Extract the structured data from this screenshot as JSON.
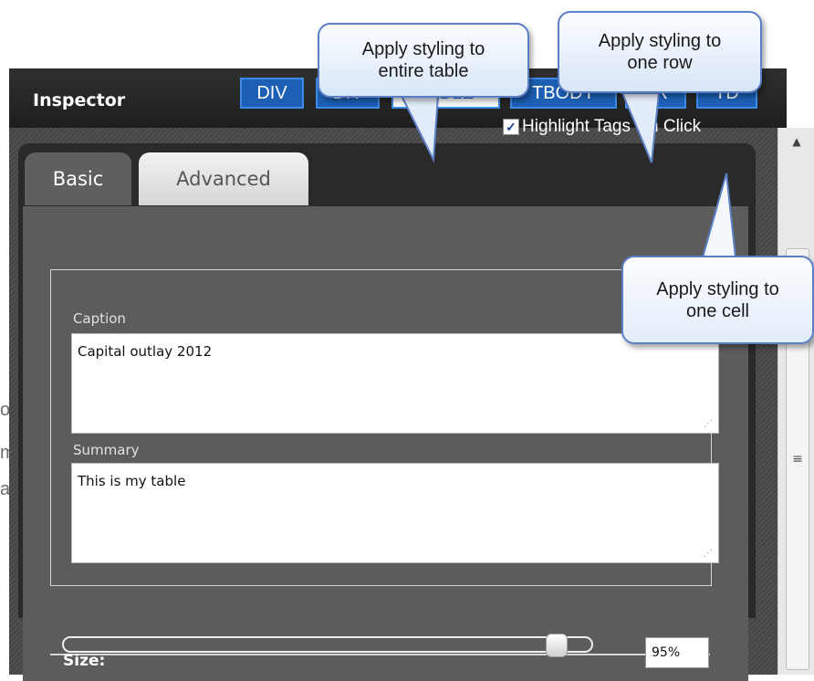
{
  "inspector": {
    "title": "Inspector",
    "tags": [
      "DIV",
      "DIV",
      "TABLE",
      "TBODY",
      "TR",
      "TD"
    ],
    "active_tag": "TABLE",
    "highlight_label": "Highlight Tags On Click",
    "highlight_checked": true
  },
  "tabs": {
    "basic": "Basic",
    "advanced": "Advanced",
    "active": "Basic"
  },
  "basic": {
    "caption_label": "Caption",
    "caption_value": "Capital outlay 2012",
    "summary_label": "Summary",
    "summary_value": "This is my table",
    "size_label": "Size:",
    "size_value": "95%",
    "size_fraction": 0.95
  },
  "callouts": {
    "table": "Apply styling to\nentire table",
    "row": "Apply styling to\none row",
    "cell": "Apply styling to\none cell"
  },
  "colors": {
    "tag_bg": "#1c5fb4",
    "tag_border": "#3c8be8",
    "callout_border": "#5a7fc4"
  },
  "icons": [
    "minimize-icon",
    "checkbox-icon",
    "resize-grip-icon",
    "scroll-up-icon",
    "scroll-thumb-grip-icon"
  ]
}
